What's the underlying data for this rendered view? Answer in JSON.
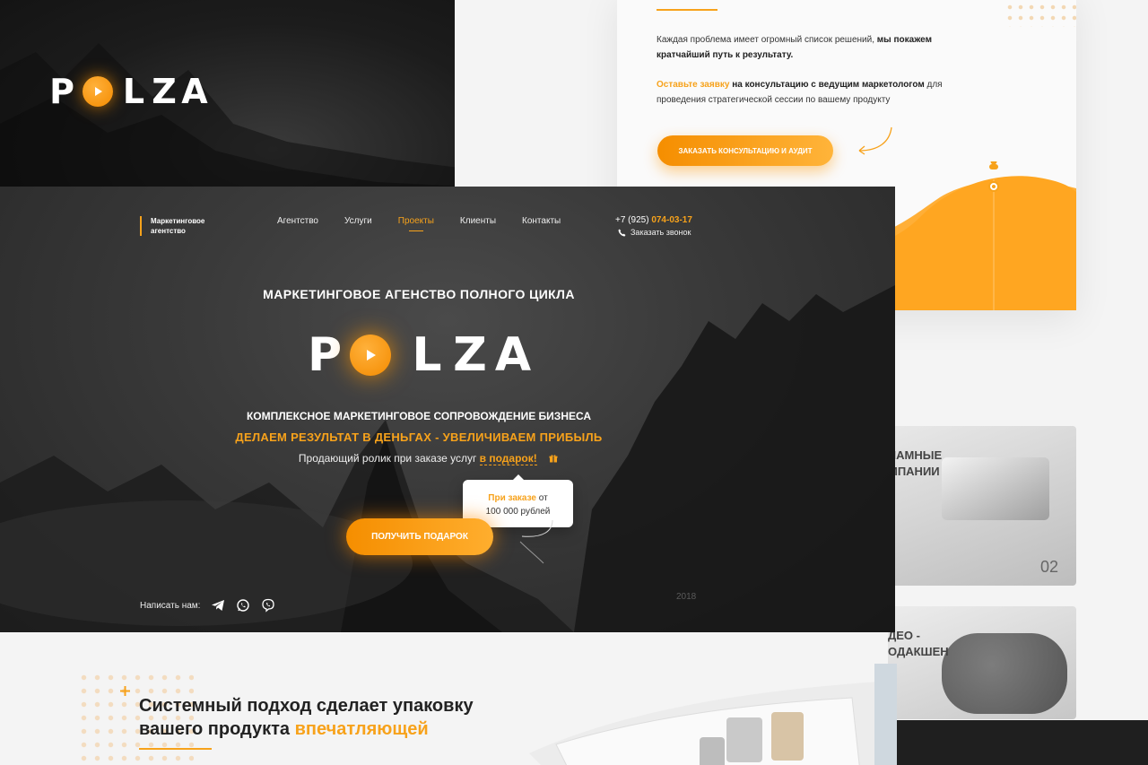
{
  "brand": {
    "logo_letters": [
      "P",
      "L",
      "Z",
      "A"
    ],
    "accent_color": "#f7a21b",
    "tagline": "Маркетинговое агентство"
  },
  "consult_card": {
    "p1_text": "Каждая проблема имеет огромный список решений,",
    "p1_bold": "мы покажем кратчайший путь к результату.",
    "p2_link": "Оставьте заявку",
    "p2_bold": "на консультацию с ведущим маркетологом",
    "p2_text": "для проведения стратегической сессии по вашему продукту",
    "button_label": "ЗАКАЗАТЬ КОНСУЛЬТАЦИЮ И АУДИТ"
  },
  "services": [
    {
      "title": "ЛАМНЫЕ\nМПАНИИ",
      "number": "02"
    },
    {
      "title": "ДЕО -\nОДАКШЕН",
      "number": ""
    }
  ],
  "nav": {
    "items": [
      {
        "label": "Агентство",
        "active": false
      },
      {
        "label": "Услуги",
        "active": false
      },
      {
        "label": "Проекты",
        "active": true
      },
      {
        "label": "Клиенты",
        "active": false
      },
      {
        "label": "Контакты",
        "active": false
      }
    ],
    "phone_prefix": "+7 (925)",
    "phone_number": "074-03-17",
    "callback_label": "Заказать звонок"
  },
  "hero": {
    "kicker": "МАРКЕТИНГОВОЕ АГЕНСТВО ПОЛНОГО ЦИКЛА",
    "sub1": "КОМПЛЕКСНОЕ МАРКЕТИНГОВОЕ СОПРОВОЖДЕНИЕ БИЗНЕСА",
    "sub2": "ДЕЛАЕМ РЕЗУЛЬТАТ В ДЕНЬГАХ - УВЕЛИЧИВАЕМ ПРИБЫЛЬ",
    "sub3_text": "Продающий ролик при заказе услуг",
    "sub3_link": "в подарок!",
    "tooltip_hl": "При заказе",
    "tooltip_from": "от",
    "tooltip_amount": "100 000 рублей",
    "button_label": "ПОЛУЧИТЬ ПОДАРОК",
    "socials_label": "Написать нам:",
    "social_icons": [
      "telegram-icon",
      "whatsapp-icon",
      "viber-icon"
    ],
    "year": "2018"
  },
  "bottom": {
    "heading_line1": "Системный подход сделает упаковку",
    "heading_line2_plain": "вашего продукта",
    "heading_line2_hl": "впечатляющей"
  }
}
